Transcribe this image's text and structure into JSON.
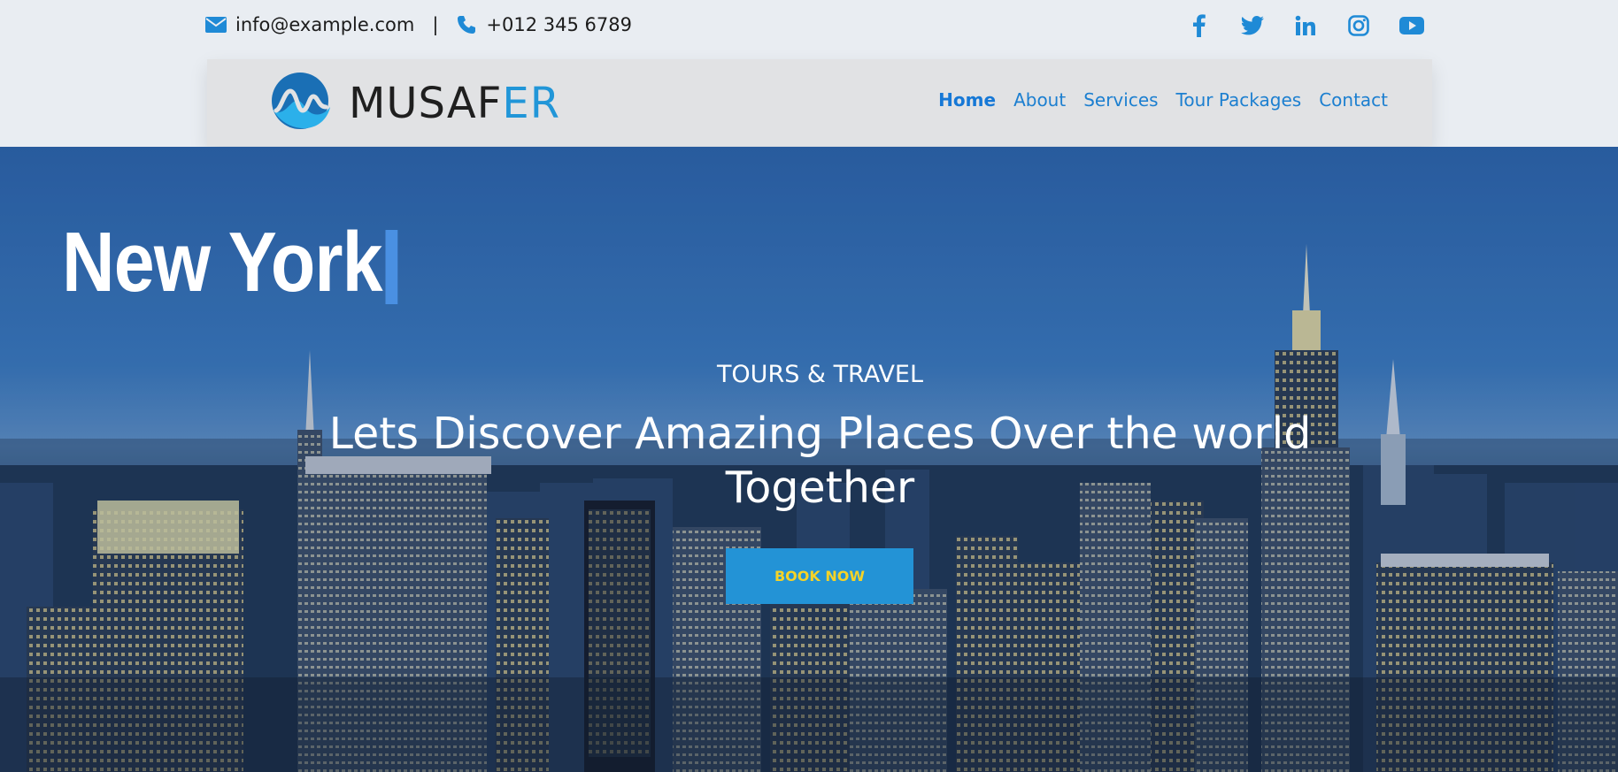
{
  "contact": {
    "email": "info@example.com",
    "separator": "|",
    "phone": "+012 345 6789",
    "email_icon": "envelope-icon",
    "phone_icon": "phone-icon"
  },
  "social": [
    "facebook-icon",
    "twitter-icon",
    "linkedin-icon",
    "instagram-icon",
    "youtube-icon"
  ],
  "brand": {
    "name_part1": "MUSAF",
    "name_part2": "ER",
    "logo_icon": "wave-logo-icon"
  },
  "nav": {
    "items": [
      "Home",
      "About",
      "Services",
      "Tour Packages",
      "Contact"
    ],
    "active": "Home"
  },
  "hero": {
    "city_title": "New York",
    "subtitle": "TOURS & TRAVEL",
    "headline": "Lets Discover Amazing Places Over the world Together",
    "button_label": "BOOK NOW"
  },
  "colors": {
    "accent": "#2393d6",
    "nav_link": "#1c7fd0",
    "button_text": "#f5d327",
    "topbar_bg": "#e9edf2"
  }
}
